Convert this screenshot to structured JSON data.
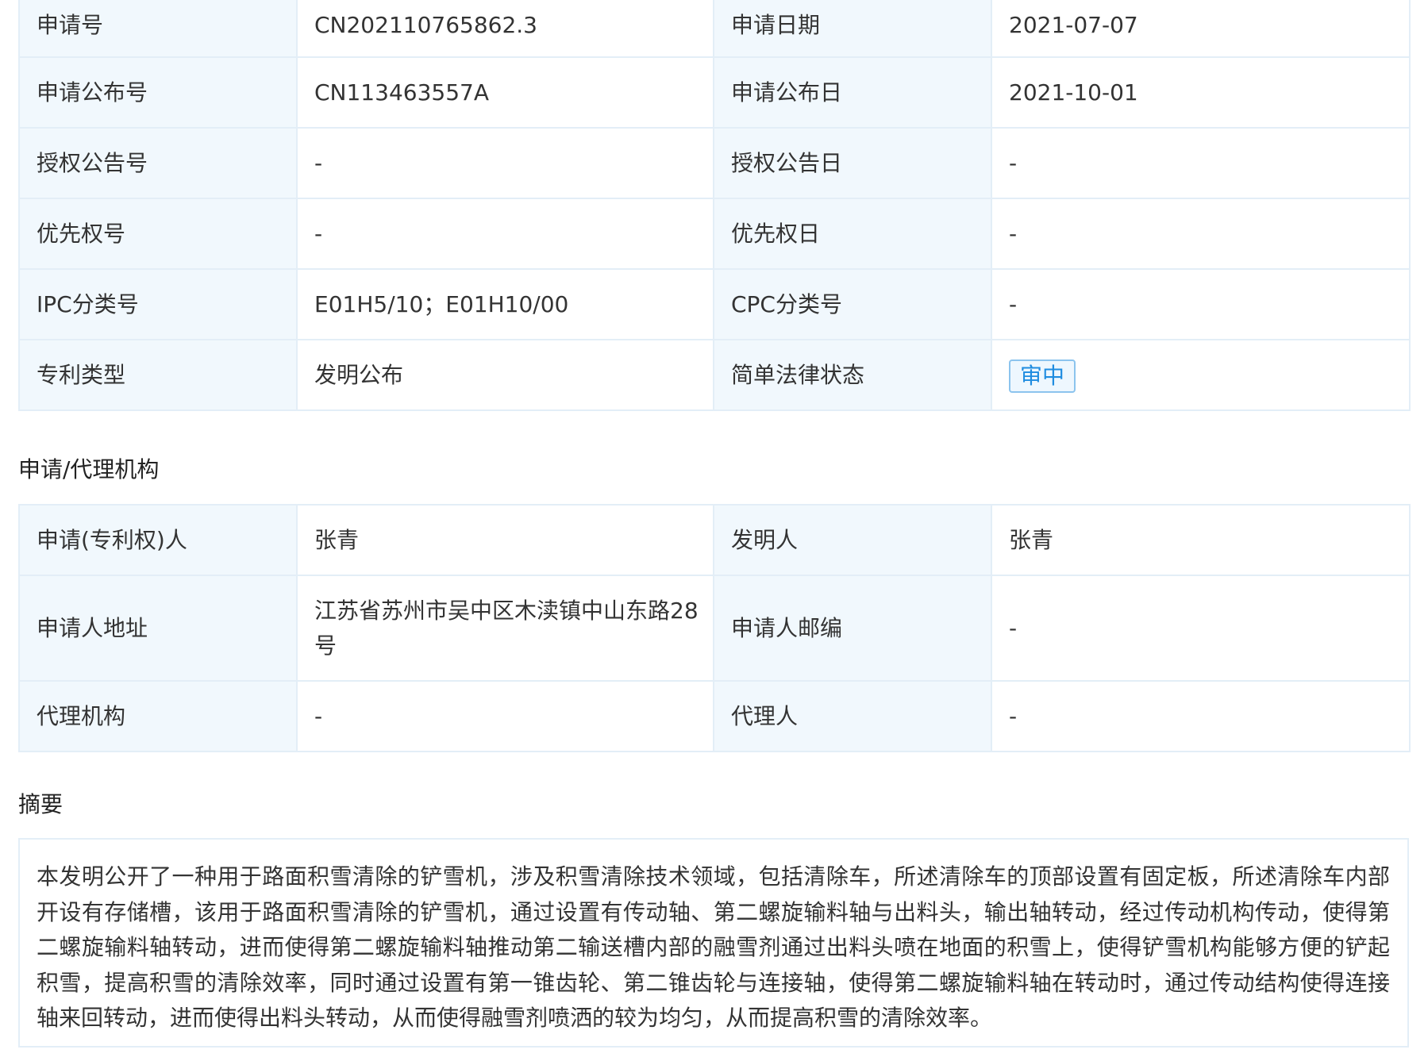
{
  "bibliographic": {
    "rows": [
      {
        "label1": "申请号",
        "value1": "CN202110765862.3",
        "label2": "申请日期",
        "value2": "2021-07-07"
      },
      {
        "label1": "申请公布号",
        "value1": "CN113463557A",
        "label2": "申请公布日",
        "value2": "2021-10-01"
      },
      {
        "label1": "授权公告号",
        "value1": "-",
        "label2": "授权公告日",
        "value2": "-"
      },
      {
        "label1": "优先权号",
        "value1": "-",
        "label2": "优先权日",
        "value2": "-"
      },
      {
        "label1": "IPC分类号",
        "value1": "E01H5/10；E01H10/00",
        "label2": "CPC分类号",
        "value2": "-"
      },
      {
        "label1": "专利类型",
        "value1": "发明公布",
        "label2": "简单法律状态",
        "value2": "审中"
      }
    ]
  },
  "agency": {
    "title": "申请/代理机构",
    "rows": [
      {
        "label1": "申请(专利权)人",
        "value1": "张青",
        "label2": "发明人",
        "value2": "张青"
      },
      {
        "label1": "申请人地址",
        "value1": "江苏省苏州市吴中区木渎镇中山东路28号",
        "label2": "申请人邮编",
        "value2": "-"
      },
      {
        "label1": "代理机构",
        "value1": "-",
        "label2": "代理人",
        "value2": "-"
      }
    ]
  },
  "abstract": {
    "title": "摘要",
    "text": "本发明公开了一种用于路面积雪清除的铲雪机，涉及积雪清除技术领域，包括清除车，所述清除车的顶部设置有固定板，所述清除车内部开设有存储槽，该用于路面积雪清除的铲雪机，通过设置有传动轴、第二螺旋输料轴与出料头，输出轴转动，经过传动机构传动，使得第二螺旋输料轴转动，进而使得第二螺旋输料轴推动第二输送槽内部的融雪剂通过出料头喷在地面的积雪上，使得铲雪机构能够方便的铲起积雪，提高积雪的清除效率，同时通过设置有第一锥齿轮、第二锥齿轮与连接轴，使得第二螺旋输料轴在转动时，通过传动结构使得连接轴来回转动，进而使得出料头转动，从而使得融雪剂喷洒的较为均匀，从而提高积雪的清除效率。"
  },
  "colors": {
    "label_bg": "#f1f8fd",
    "border": "#e3eef7",
    "status_text": "#1f8ce0",
    "status_border": "#8cc4ee"
  }
}
